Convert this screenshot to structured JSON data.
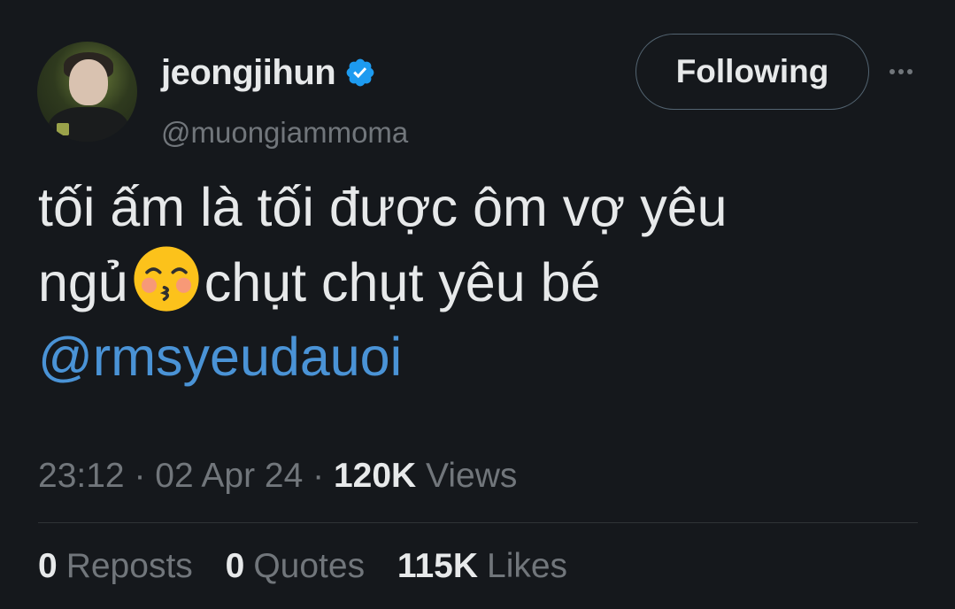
{
  "user": {
    "display_name": "jeongjihun",
    "handle": "@muongiammoma",
    "verified": true,
    "avatar_icon": "profile-photo"
  },
  "header": {
    "follow_label": "Following",
    "more_icon": "more-dots-icon"
  },
  "tweet": {
    "line1": "tối ấm là tối được ôm vợ yêu",
    "line2_before": "ngủ",
    "emoji": "kissing-face-with-closed-eyes",
    "line2_after": "chụt chụt yêu bé",
    "mention": "@rmsyeudauoi"
  },
  "meta": {
    "time": "23:12",
    "sep1": "·",
    "date": "02 Apr 24",
    "sep2": "·",
    "views_count": "120K",
    "views_label": "Views"
  },
  "stats": {
    "reposts_count": "0",
    "reposts_label": "Reposts",
    "quotes_count": "0",
    "quotes_label": "Quotes",
    "likes_count": "115K",
    "likes_label": "Likes"
  },
  "colors": {
    "background": "#15181c",
    "text": "#e7e9ea",
    "muted": "#71767b",
    "link": "#4a93d6",
    "verified": "#1d9bf0"
  }
}
